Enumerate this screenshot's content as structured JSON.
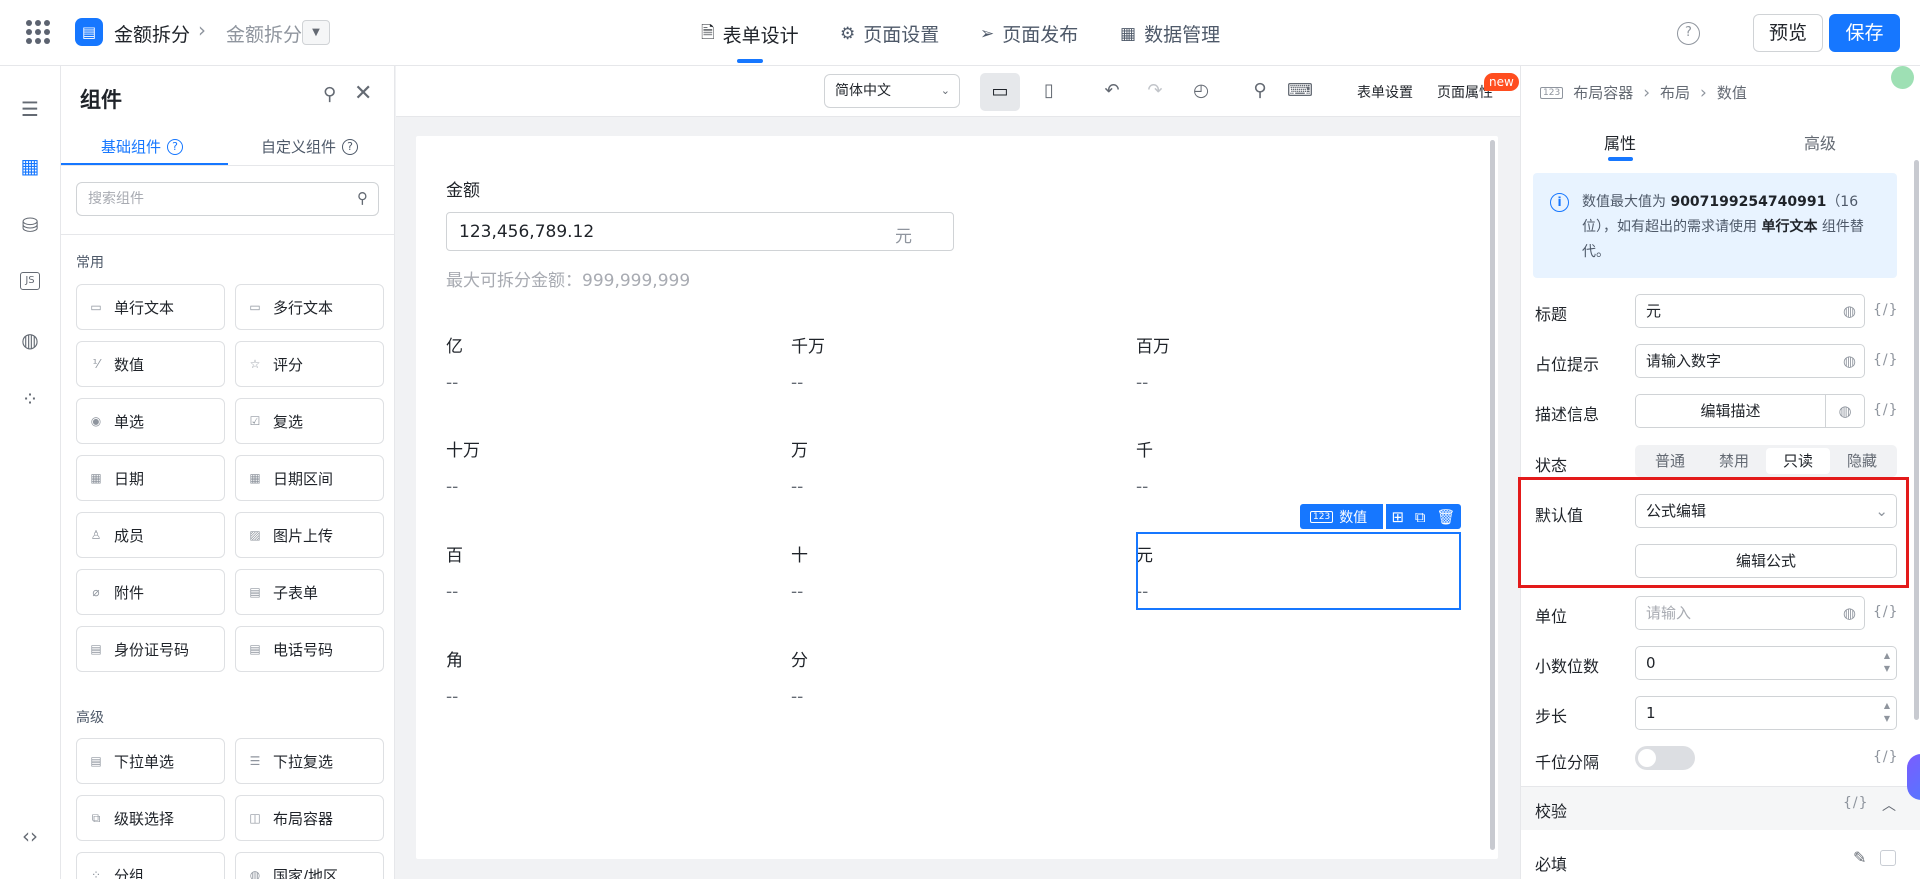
{
  "app": {
    "title": "金额拆分",
    "breadcrumb": "金额拆分",
    "dropdown_icon": "caret-down"
  },
  "nav": {
    "tabs": [
      {
        "label": "表单设计",
        "icon": "document-icon",
        "active": true
      },
      {
        "label": "页面设置",
        "icon": "gear-icon",
        "active": false
      },
      {
        "label": "页面发布",
        "icon": "send-icon",
        "active": false
      },
      {
        "label": "数据管理",
        "icon": "table-icon",
        "active": false
      }
    ],
    "preview": "预览",
    "save": "保存"
  },
  "components": {
    "title": "组件",
    "tabs": [
      "基础组件",
      "自定义组件"
    ],
    "search_placeholder": "搜索组件",
    "common_label": "常用",
    "common": [
      "单行文本",
      "多行文本",
      "数值",
      "评分",
      "单选",
      "复选",
      "日期",
      "日期区间",
      "成员",
      "图片上传",
      "附件",
      "子表单",
      "身份证号码",
      "电话号码"
    ],
    "advanced_label": "高级",
    "advanced": [
      "下拉单选",
      "下拉复选",
      "级联选择",
      "布局容器",
      "分组",
      "国家/地区"
    ]
  },
  "toolbar": {
    "language": "简体中文",
    "form_settings": "表单设置",
    "page_attrs": "页面属性",
    "new_badge": "new"
  },
  "form": {
    "amount_label": "金额",
    "amount_value": "123,456,789.12",
    "amount_unit": "元",
    "help": "最大可拆分金额：999,999,999",
    "digits": [
      {
        "label": "亿",
        "value": "--"
      },
      {
        "label": "千万",
        "value": "--"
      },
      {
        "label": "百万",
        "value": "--"
      },
      {
        "label": "十万",
        "value": "--"
      },
      {
        "label": "万",
        "value": "--"
      },
      {
        "label": "千",
        "value": "--"
      },
      {
        "label": "百",
        "value": "--"
      },
      {
        "label": "十",
        "value": "--"
      },
      {
        "label": "元",
        "value": "--"
      },
      {
        "label": "角",
        "value": "--"
      },
      {
        "label": "分",
        "value": "--"
      }
    ],
    "selected_tag": "数值"
  },
  "props": {
    "breadcrumb": [
      "布局容器",
      "布局",
      "数值"
    ],
    "tabs": [
      "属性",
      "高级"
    ],
    "info_pre": "数值最大值为",
    "info_max": "9007199254740991",
    "info_mid": "（16位），如有超出的需求请使用",
    "info_comp": "单行文本",
    "info_post": "组件替代。",
    "title_label": "标题",
    "title_value": "元",
    "placeholder_label": "占位提示",
    "placeholder_value": "请输入数字",
    "desc_label": "描述信息",
    "desc_button": "编辑描述",
    "state_label": "状态",
    "states": [
      "普通",
      "禁用",
      "只读",
      "隐藏"
    ],
    "active_state": "只读",
    "default_label": "默认值",
    "default_select": "公式编辑",
    "formula_button": "编辑公式",
    "unit_label": "单位",
    "unit_placeholder": "请输入",
    "decimals_label": "小数位数",
    "decimals_value": "0",
    "step_label": "步长",
    "step_value": "1",
    "thousands_label": "千位分隔",
    "thousands_on": false,
    "validation_label": "校验",
    "required_label": "必填",
    "fx": "{/}"
  }
}
